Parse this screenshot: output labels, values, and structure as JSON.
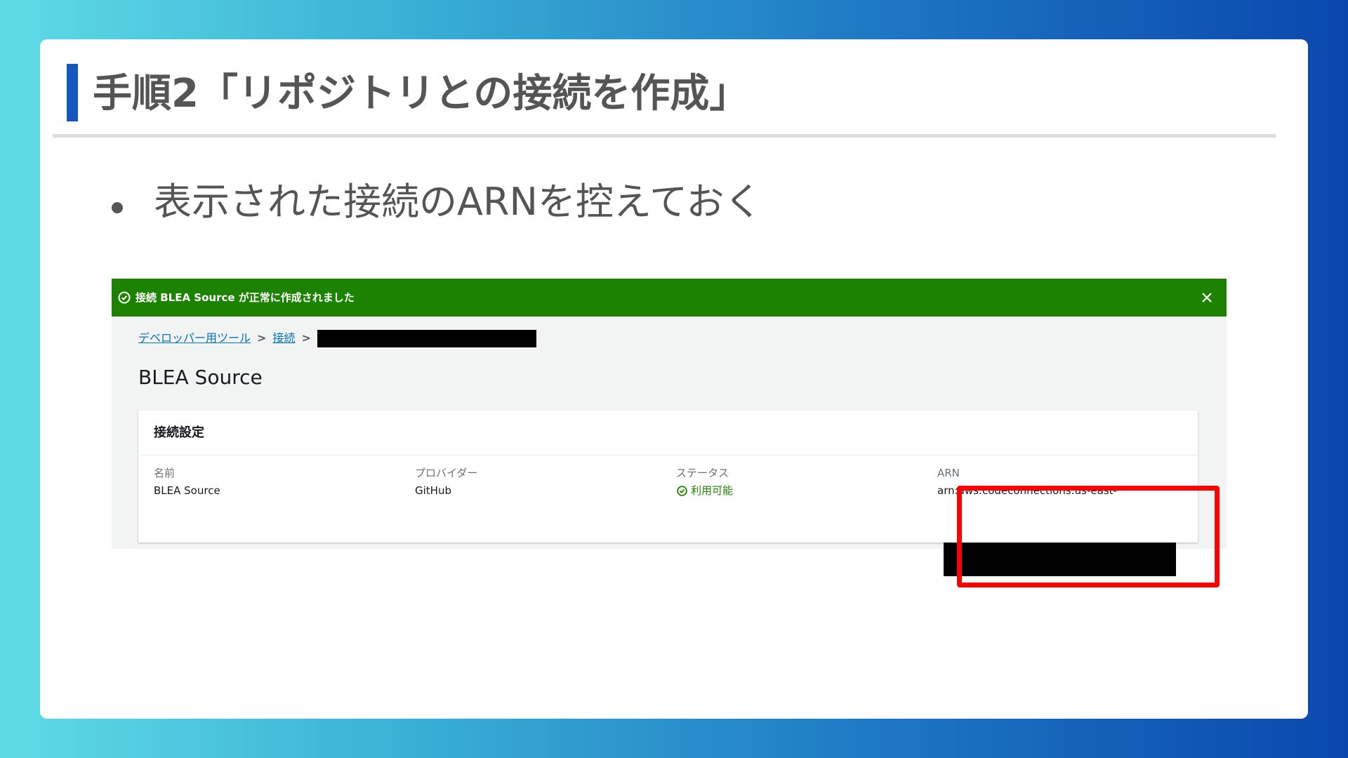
{
  "slide": {
    "title": "手順2「リポジトリとの接続を作成」",
    "bullet": "表示された接続のARNを控えておく"
  },
  "console": {
    "flash": {
      "message": "接続 BLEA Source が正常に作成されました",
      "icon": "check-circle-icon",
      "close_icon": "close-icon"
    },
    "breadcrumb": {
      "items": [
        "デベロッパー用ツール",
        "接続"
      ],
      "separator": ">"
    },
    "page_title": "BLEA Source",
    "card": {
      "title": "接続設定",
      "fields": [
        {
          "label": "名前",
          "value": "BLEA Source"
        },
        {
          "label": "プロバイダー",
          "value": "GitHub"
        },
        {
          "label": "ステータス",
          "value": "利用可能"
        },
        {
          "label": "ARN",
          "value": "arn:aws:codeconnections:us-east-"
        }
      ]
    }
  },
  "colors": {
    "accent": "#1456c2",
    "flash_green": "#1d8102",
    "link": "#0073bb",
    "highlight": "#ff0000"
  }
}
